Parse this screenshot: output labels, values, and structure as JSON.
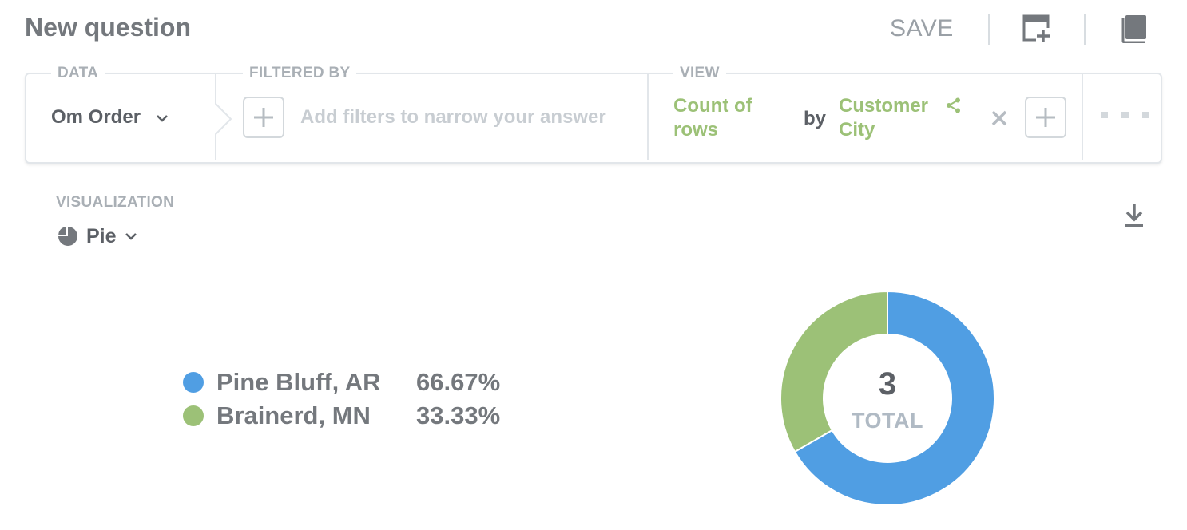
{
  "header": {
    "title": "New question",
    "save_label": "SAVE",
    "icons": [
      "add-to-dashboard-icon",
      "reference-book-icon"
    ]
  },
  "query_builder": {
    "data": {
      "label": "DATA",
      "source": "Om Order"
    },
    "filter": {
      "label": "FILTERED BY",
      "placeholder": "Add filters to narrow your answer"
    },
    "view": {
      "label": "VIEW",
      "aggregation_line1": "Count of",
      "aggregation_line2": "rows",
      "by": "by",
      "breakout_line1": "Customer",
      "breakout_line2": "City"
    }
  },
  "visualization": {
    "label": "VISUALIZATION",
    "type": "Pie"
  },
  "chart_data": {
    "type": "pie",
    "style": "donut",
    "categories": [
      "Pine Bluff, AR",
      "Brainerd, MN"
    ],
    "values": [
      2,
      1
    ],
    "percent_labels": [
      "66.67%",
      "33.33%"
    ],
    "colors": [
      "#509ee3",
      "#9cc177"
    ],
    "total_value": "3",
    "total_label": "TOTAL"
  },
  "colors": {
    "accent_green": "#9cc177",
    "accent_blue": "#509ee3",
    "text_dark": "#74787d"
  }
}
